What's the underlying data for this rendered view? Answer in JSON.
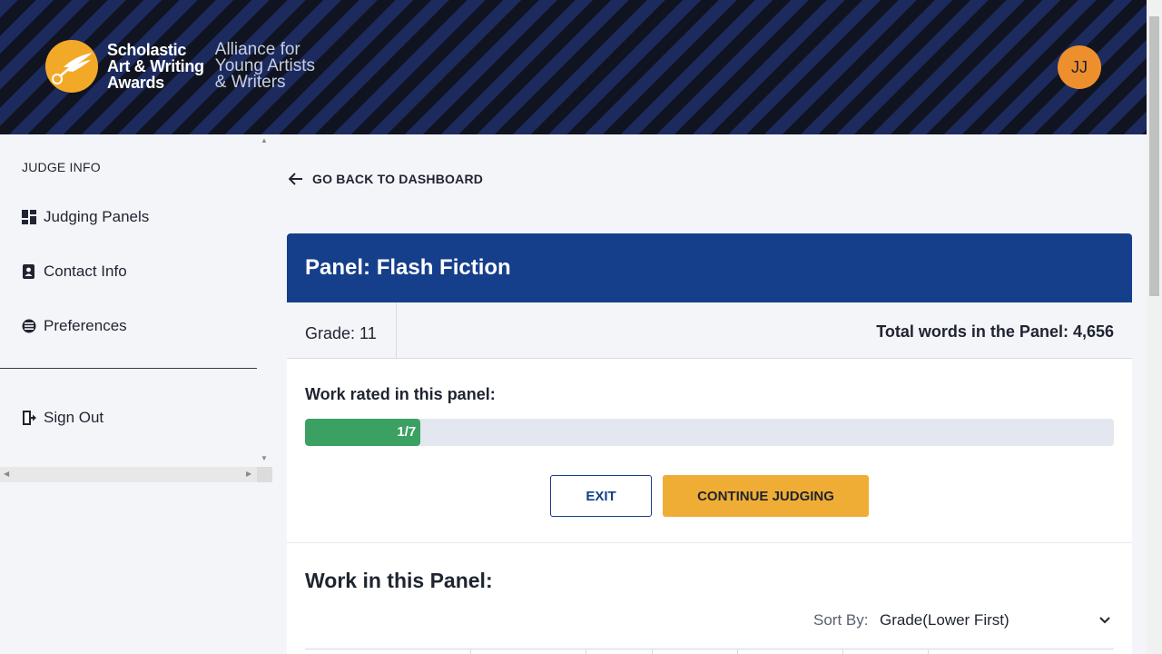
{
  "header": {
    "logo_name": "Scholastic Art & Writing Awards",
    "logo_lines": [
      "Scholastic",
      "Art & Writing",
      "Awards"
    ],
    "logo_sub_lines": [
      "Alliance for",
      "Young Artists",
      "& Writers"
    ],
    "avatar_initials": "JJ",
    "accent": "#f3a928"
  },
  "sidebar": {
    "heading": "JUDGE INFO",
    "items": [
      {
        "label": "Judging Panels",
        "icon": "dashboard-icon"
      },
      {
        "label": "Contact Info",
        "icon": "contact-book-icon"
      },
      {
        "label": "Preferences",
        "icon": "preferences-icon"
      }
    ],
    "sign_out": {
      "label": "Sign Out",
      "icon": "sign-out-icon"
    }
  },
  "main": {
    "back_label": "GO BACK TO DASHBOARD",
    "panel": {
      "title": "Panel: Flash Fiction",
      "grade": "Grade: 11",
      "total_words": "Total words in the Panel: 4,656",
      "rated_label": "Work rated in this panel:",
      "progress_text": "1/7",
      "progress_fraction": 0.142857,
      "exit_label": "EXIT",
      "continue_label": "CONTINUE JUDGING",
      "work_title": "Work in this Panel:",
      "sort_label": "Sort By:",
      "sort_value": "Grade(Lower First)"
    },
    "colors": {
      "panel_header": "#163f8b",
      "progress_fill": "#3aa163",
      "continue_button": "#f0ad35",
      "avatar": "#ee8f2e"
    }
  }
}
